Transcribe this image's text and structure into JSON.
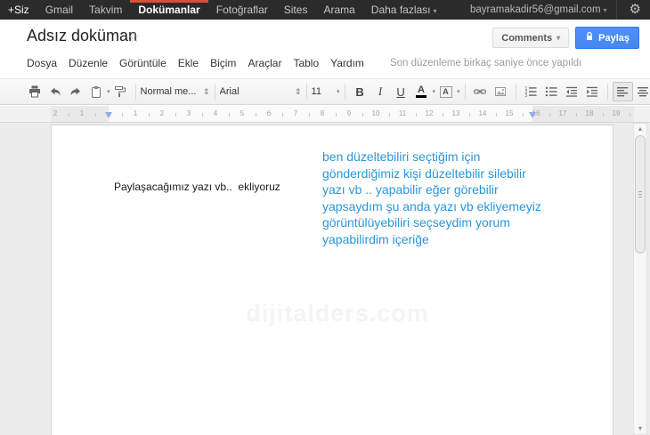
{
  "icons": {
    "caret_down": "▾",
    "updown": "⇕",
    "gear": "⚙",
    "star": "☆",
    "scroll_up": "▴",
    "scroll_down": "▾"
  },
  "topbar": {
    "items": [
      "+Siz",
      "Gmail",
      "Takvim",
      "Dokümanlar",
      "Fotoğraflar",
      "Sites",
      "Arama",
      "Daha fazlası"
    ],
    "active_item": "Dokümanlar",
    "account": "bayramakadir56@gmail.com"
  },
  "header": {
    "title": "Adsız doküman",
    "comments_label": "Comments",
    "share_label": "Paylaş",
    "menu_items": [
      "Dosya",
      "Düzenle",
      "Görüntüle",
      "Ekle",
      "Biçim",
      "Araçlar",
      "Tablo",
      "Yardım"
    ],
    "status": "Son düzenleme birkaç saniye önce yapıldı"
  },
  "toolbar": {
    "style_label": "Normal me...",
    "font_label": "Arial",
    "size_label": "11",
    "bold_label": "B",
    "italic_label": "I",
    "underline_label": "U",
    "text_color_label": "A",
    "highlight_label": "A"
  },
  "ruler": {
    "left_numbers": [
      "2",
      "1"
    ],
    "numbers": [
      "1",
      "2",
      "3",
      "4",
      "5",
      "6",
      "7",
      "8",
      "9",
      "10",
      "11",
      "12",
      "13",
      "14",
      "15",
      "16",
      "17",
      "18",
      "19"
    ]
  },
  "document": {
    "black_text": "Paylaşacağımız yazı vb..  ekliyoruz",
    "blue_text_lines": [
      "ben düzeltebiliri seçtiğim için",
      "gönderdiğimiz kişi düzeltebilir silebilir",
      "yazı vb ..  yapabilir eğer görebilir",
      "yapsaydım şu anda yazı vb ekliyemeyiz",
      "görüntülüyebiliri seçseydim yorum",
      "yapabilirdim içeriğe"
    ],
    "blue_color": "#2b96d9",
    "watermark": "dijitalders.com"
  },
  "colors": {
    "topbar_bg": "#2b2b2b",
    "topbar_active_red": "#dd4b39",
    "share_button_blue": "#4d90fe",
    "canvas_gray": "#ececec"
  }
}
